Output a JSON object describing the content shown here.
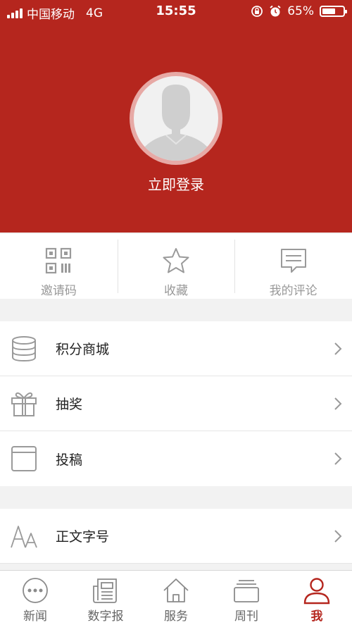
{
  "status_bar": {
    "carrier": "中国移动",
    "network": "4G",
    "time": "15:55",
    "battery_percent": "65%",
    "battery_level": 0.65
  },
  "profile": {
    "login_label": "立即登录"
  },
  "quick_actions": [
    {
      "label": "邀请码",
      "icon": "qr-code-icon"
    },
    {
      "label": "收藏",
      "icon": "star-icon"
    },
    {
      "label": "我的评论",
      "icon": "comment-icon"
    }
  ],
  "menu_group_1": [
    {
      "label": "积分商城",
      "icon": "database-icon"
    },
    {
      "label": "抽奖",
      "icon": "gift-icon"
    },
    {
      "label": "投稿",
      "icon": "window-icon"
    }
  ],
  "menu_group_2": [
    {
      "label": "正文字号",
      "icon": "font-size-icon"
    }
  ],
  "tabs": [
    {
      "label": "新闻",
      "icon": "news-icon",
      "active": false
    },
    {
      "label": "数字报",
      "icon": "newspaper-icon",
      "active": false
    },
    {
      "label": "服务",
      "icon": "home-icon",
      "active": false
    },
    {
      "label": "周刊",
      "icon": "weekly-icon",
      "active": false
    },
    {
      "label": "我",
      "icon": "user-icon",
      "active": true
    }
  ],
  "colors": {
    "brand_red": "#b5261e",
    "icon_gray": "#9a9a9a",
    "background": "#f2f2f2"
  }
}
